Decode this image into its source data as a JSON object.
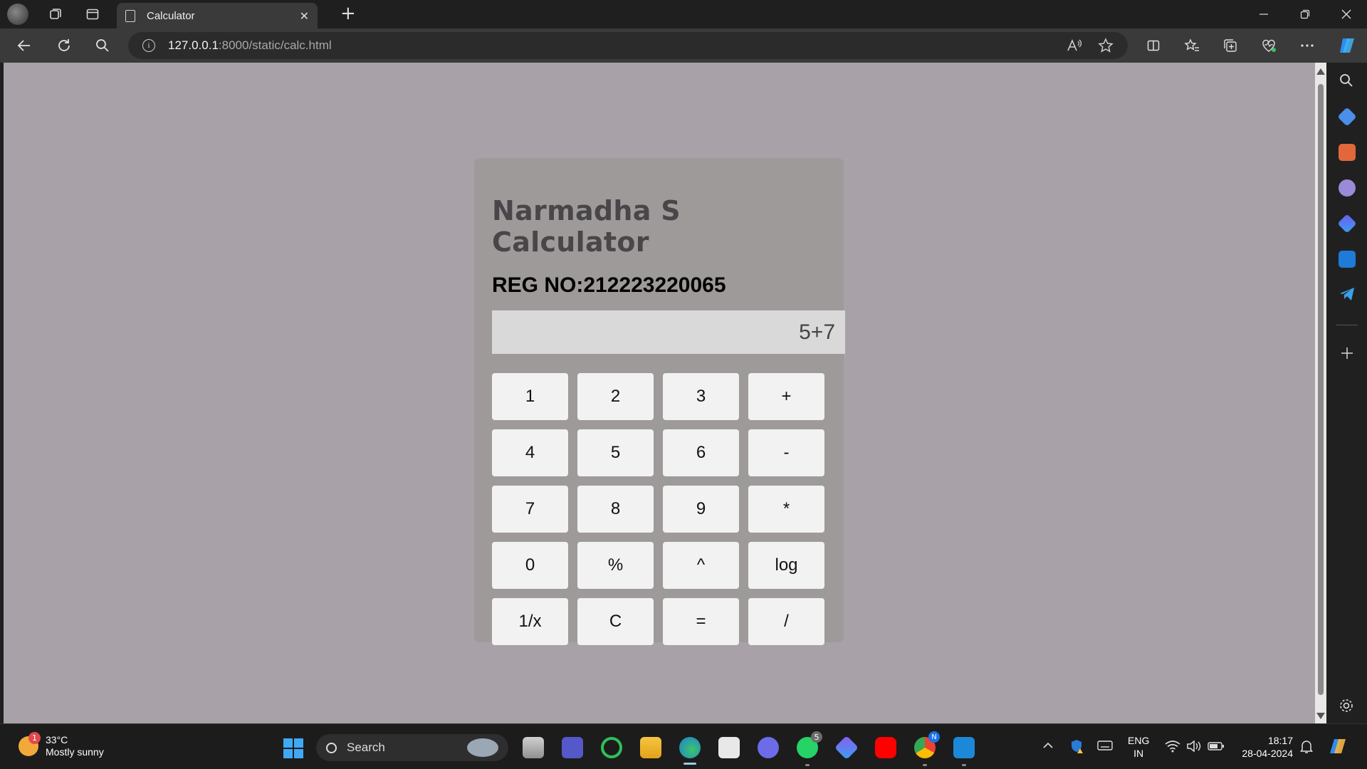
{
  "browser": {
    "tab_title": "Calculator",
    "tab_close": "✕",
    "new_tab": "+",
    "url_host": "127.0.0.1",
    "url_path": ":8000/static/calc.html"
  },
  "calculator": {
    "title": "Narmadha S Calculator",
    "reg_no": "REG NO:212223220065",
    "display_value": "5+7",
    "keys": [
      {
        "label": "1",
        "name": "key-1"
      },
      {
        "label": "2",
        "name": "key-2"
      },
      {
        "label": "3",
        "name": "key-3"
      },
      {
        "label": "+",
        "name": "key-plus"
      },
      {
        "label": "4",
        "name": "key-4"
      },
      {
        "label": "5",
        "name": "key-5"
      },
      {
        "label": "6",
        "name": "key-6"
      },
      {
        "label": "-",
        "name": "key-minus"
      },
      {
        "label": "7",
        "name": "key-7"
      },
      {
        "label": "8",
        "name": "key-8"
      },
      {
        "label": "9",
        "name": "key-9"
      },
      {
        "label": "*",
        "name": "key-multiply"
      },
      {
        "label": "0",
        "name": "key-0"
      },
      {
        "label": "%",
        "name": "key-percent"
      },
      {
        "label": "^",
        "name": "key-power"
      },
      {
        "label": "log",
        "name": "key-log"
      },
      {
        "label": "1/x",
        "name": "key-reciprocal"
      },
      {
        "label": "C",
        "name": "key-clear"
      },
      {
        "label": "=",
        "name": "key-equals"
      },
      {
        "label": "/",
        "name": "key-divide"
      }
    ]
  },
  "taskbar": {
    "weather_temp": "33°C",
    "weather_desc": "Mostly sunny",
    "weather_badge": "1",
    "search_label": "Search",
    "whatsapp_badge": "5",
    "chrome_badge": "N",
    "lang_top": "ENG",
    "lang_bottom": "IN",
    "time": "18:17",
    "date": "28-04-2024"
  },
  "colors": {
    "page_bg": "#a8a2a8",
    "panel_bg": "#9e9a9a",
    "display_bg": "#d9d9d9",
    "key_bg": "#f2f2f2"
  }
}
